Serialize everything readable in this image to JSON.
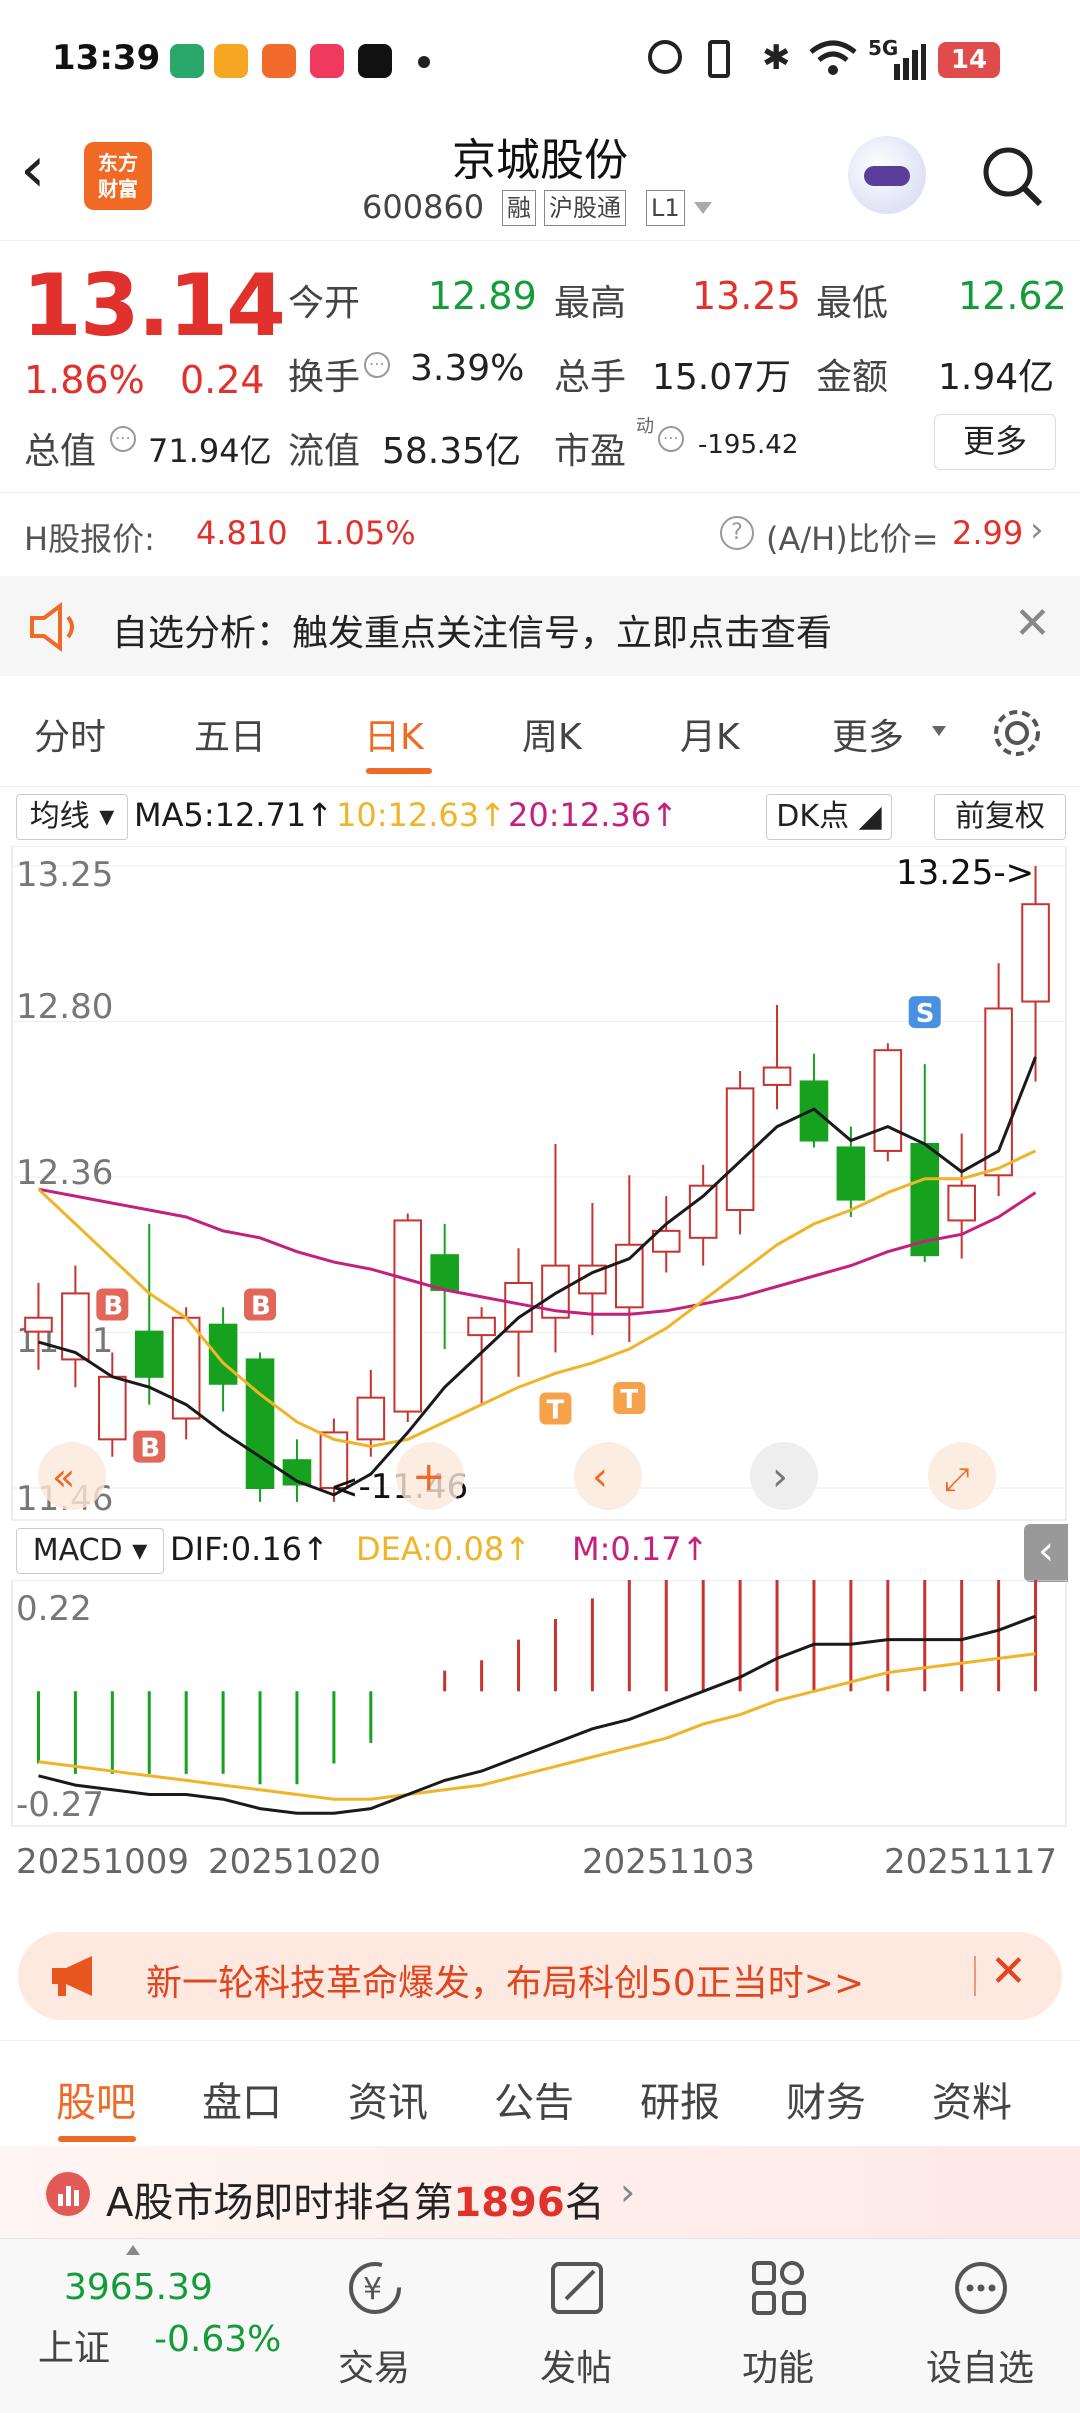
{
  "status": {
    "time": "13:39",
    "battery": "14",
    "network": "5G"
  },
  "header": {
    "title": "京城股份",
    "code": "600860",
    "tags": [
      "融",
      "沪股通",
      "L1"
    ],
    "logo_line1": "东方",
    "logo_line2": "财富"
  },
  "quote": {
    "price": "13.14",
    "change_pct": "1.86%",
    "change": "0.24",
    "open_label": "今开",
    "open": "12.89",
    "high_label": "最高",
    "high": "13.25",
    "low_label": "最低",
    "low": "12.62",
    "turnover_label": "换手",
    "turnover": "3.39%",
    "volume_label": "总手",
    "volume": "15.07万",
    "amount_label": "金额",
    "amount": "1.94亿",
    "mktcap_label": "总值",
    "mktcap": "71.94亿",
    "float_label": "流值",
    "float": "58.35亿",
    "pe_label": "市盈",
    "pe_sup": "动",
    "pe": "-195.42",
    "more": "更多"
  },
  "hshare": {
    "label": "H股报价:",
    "price": "4.810",
    "pct": "1.05%",
    "ratio_label": "(A/H)比价=",
    "ratio": "2.99"
  },
  "notice": {
    "text": "自选分析：触发重点关注信号，立即点击查看"
  },
  "period_tabs": [
    "分时",
    "五日",
    "日K",
    "周K",
    "月K",
    "更多"
  ],
  "active_period": 2,
  "ma_bar": {
    "selector": "均线",
    "ma5": "MA5:12.71↑",
    "ma10": "10:12.63↑",
    "ma20": "20:12.36↑",
    "dk": "DK点",
    "adj": "前复权"
  },
  "chart_axis": {
    "top": "13.25",
    "mid1": "12.80",
    "mid2": "12.36",
    "mid3": "11.91",
    "bottom": "11.46",
    "max_label": "13.25->",
    "min_label": "<-11.46"
  },
  "macd_bar": {
    "selector": "MACD",
    "dif": "DIF:0.16↑",
    "dea": "DEA:0.08↑",
    "m": "M:0.17↑",
    "top": "0.22",
    "bottom": "-0.27"
  },
  "dates": [
    "20251009",
    "20251020",
    "20251103",
    "20251117"
  ],
  "colors": {
    "up": "#c8322f",
    "down": "#16a21f",
    "ma5": "#1a1a1a",
    "ma10": "#f0b428",
    "ma20": "#c4207e",
    "accent": "#f06a26"
  },
  "chart_data": {
    "type": "candlestick",
    "ylim": [
      11.46,
      13.25
    ],
    "candles": [
      {
        "o": 11.91,
        "c": 11.95,
        "h": 12.05,
        "l": 11.8
      },
      {
        "o": 11.83,
        "c": 12.02,
        "h": 12.1,
        "l": 11.75
      },
      {
        "o": 11.6,
        "c": 11.78,
        "h": 11.85,
        "l": 11.55
      },
      {
        "o": 11.91,
        "c": 11.78,
        "h": 12.22,
        "l": 11.7
      },
      {
        "o": 11.66,
        "c": 11.95,
        "h": 11.98,
        "l": 11.6
      },
      {
        "o": 11.93,
        "c": 11.76,
        "h": 11.98,
        "l": 11.68
      },
      {
        "o": 11.83,
        "c": 11.46,
        "h": 11.85,
        "l": 11.42
      },
      {
        "o": 11.54,
        "c": 11.47,
        "h": 11.6,
        "l": 11.42
      },
      {
        "o": 11.46,
        "c": 11.62,
        "h": 11.66,
        "l": 11.42
      },
      {
        "o": 11.6,
        "c": 11.72,
        "h": 11.8,
        "l": 11.55
      },
      {
        "o": 11.68,
        "c": 12.23,
        "h": 12.25,
        "l": 11.65
      },
      {
        "o": 12.13,
        "c": 12.03,
        "h": 12.22,
        "l": 11.86
      },
      {
        "o": 11.9,
        "c": 11.95,
        "h": 11.98,
        "l": 11.7
      },
      {
        "o": 11.91,
        "c": 12.05,
        "h": 12.15,
        "l": 11.78
      },
      {
        "o": 11.95,
        "c": 12.1,
        "h": 12.45,
        "l": 11.85
      },
      {
        "o": 12.02,
        "c": 12.1,
        "h": 12.28,
        "l": 11.9
      },
      {
        "o": 11.98,
        "c": 12.16,
        "h": 12.36,
        "l": 11.88
      },
      {
        "o": 12.14,
        "c": 12.2,
        "h": 12.3,
        "l": 12.08
      },
      {
        "o": 12.18,
        "c": 12.33,
        "h": 12.39,
        "l": 12.1
      },
      {
        "o": 12.26,
        "c": 12.61,
        "h": 12.66,
        "l": 12.19
      },
      {
        "o": 12.62,
        "c": 12.67,
        "h": 12.85,
        "l": 12.55
      },
      {
        "o": 12.63,
        "c": 12.46,
        "h": 12.71,
        "l": 12.44
      },
      {
        "o": 12.44,
        "c": 12.29,
        "h": 12.5,
        "l": 12.24
      },
      {
        "o": 12.43,
        "c": 12.72,
        "h": 12.74,
        "l": 12.4
      },
      {
        "o": 12.45,
        "c": 12.13,
        "h": 12.68,
        "l": 12.11
      },
      {
        "o": 12.23,
        "c": 12.33,
        "h": 12.48,
        "l": 12.12
      },
      {
        "o": 12.36,
        "c": 12.84,
        "h": 12.97,
        "l": 12.3
      },
      {
        "o": 12.86,
        "c": 13.14,
        "h": 13.25,
        "l": 12.63
      }
    ],
    "ma5": [
      11.88,
      11.85,
      11.78,
      11.75,
      11.7,
      11.62,
      11.55,
      11.48,
      11.44,
      11.5,
      11.62,
      11.75,
      11.85,
      11.95,
      12.02,
      12.08,
      12.12,
      12.22,
      12.3,
      12.4,
      12.5,
      12.55,
      12.46,
      12.5,
      12.45,
      12.37,
      12.43,
      12.7
    ],
    "ma10": [
      12.32,
      12.22,
      12.12,
      12.02,
      11.95,
      11.82,
      11.73,
      11.65,
      11.6,
      11.58,
      11.6,
      11.65,
      11.7,
      11.75,
      11.79,
      11.82,
      11.86,
      11.92,
      12.0,
      12.08,
      12.16,
      12.22,
      12.26,
      12.31,
      12.35,
      12.35,
      12.38,
      12.43
    ],
    "ma20": [
      12.32,
      12.3,
      12.28,
      12.26,
      12.24,
      12.2,
      12.18,
      12.14,
      12.11,
      12.09,
      12.06,
      12.03,
      12.01,
      11.99,
      11.97,
      11.96,
      11.96,
      11.97,
      11.99,
      12.01,
      12.04,
      12.07,
      12.1,
      12.14,
      12.17,
      12.19,
      12.24,
      12.31
    ],
    "signals": [
      {
        "i": 2,
        "t": "B"
      },
      {
        "i": 3,
        "t": "B"
      },
      {
        "i": 6,
        "t": "B"
      },
      {
        "i": 14,
        "t": "T"
      },
      {
        "i": 16,
        "t": "T"
      },
      {
        "i": 24,
        "t": "S"
      }
    ],
    "macd": {
      "ylim": [
        -0.27,
        0.22
      ],
      "dif": [
        -0.18,
        -0.2,
        -0.21,
        -0.22,
        -0.22,
        -0.23,
        -0.25,
        -0.26,
        -0.26,
        -0.25,
        -0.22,
        -0.19,
        -0.17,
        -0.14,
        -0.11,
        -0.08,
        -0.06,
        -0.03,
        0.0,
        0.03,
        0.07,
        0.1,
        0.1,
        0.11,
        0.11,
        0.11,
        0.13,
        0.16
      ],
      "dea": [
        -0.15,
        -0.16,
        -0.17,
        -0.18,
        -0.19,
        -0.2,
        -0.21,
        -0.22,
        -0.23,
        -0.23,
        -0.22,
        -0.21,
        -0.2,
        -0.18,
        -0.16,
        -0.14,
        -0.12,
        -0.1,
        -0.07,
        -0.05,
        -0.02,
        0.0,
        0.02,
        0.04,
        0.05,
        0.06,
        0.07,
        0.08
      ],
      "hist": [
        -0.07,
        -0.08,
        -0.08,
        -0.08,
        -0.08,
        -0.08,
        -0.09,
        -0.09,
        -0.07,
        -0.05,
        0.0,
        0.02,
        0.03,
        0.05,
        0.07,
        0.09,
        0.11,
        0.14,
        0.15,
        0.17,
        0.19,
        0.2,
        0.17,
        0.14,
        0.12,
        0.11,
        0.12,
        0.17
      ]
    }
  },
  "banner": {
    "text": "新一轮科技革命爆发，布局科创50正当时>>"
  },
  "content_tabs": [
    "股吧",
    "盘口",
    "资讯",
    "公告",
    "研报",
    "财务",
    "资料"
  ],
  "rank": {
    "prefix": "A股市场即时排名第",
    "num": "1896",
    "suffix": "名"
  },
  "bottom": {
    "index_value": "3965.39",
    "index_name": "上证",
    "index_pct": "-0.63%",
    "items": [
      "交易",
      "发帖",
      "功能",
      "设自选"
    ]
  }
}
